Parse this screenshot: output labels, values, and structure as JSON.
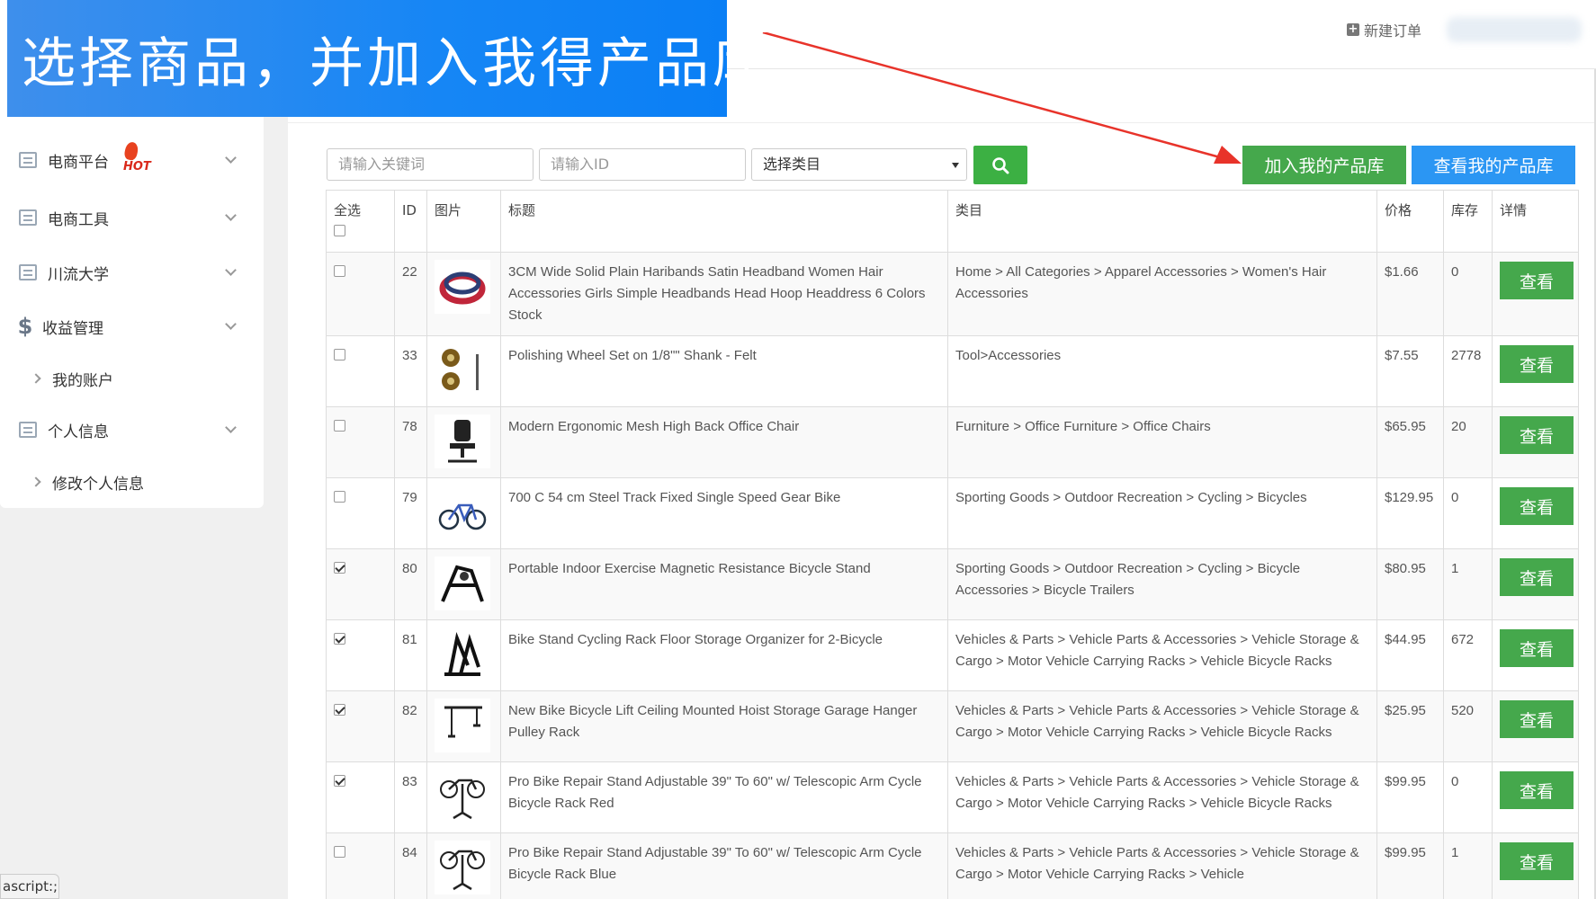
{
  "banner": {
    "text": "选择商品，并加入我得产品库"
  },
  "header": {
    "new_order_label": "新建订单"
  },
  "sidebar": {
    "items": [
      {
        "label": "电商平台",
        "badge": "HOT"
      },
      {
        "label": "电商工具"
      },
      {
        "label": "川流大学"
      },
      {
        "label": "收益管理"
      },
      {
        "label": "我的账户"
      },
      {
        "label": "个人信息"
      },
      {
        "label": "修改个人信息"
      }
    ]
  },
  "status_bar": {
    "text": "ascript:;"
  },
  "search": {
    "keyword_placeholder": "请输入关键词",
    "id_placeholder": "请输入ID",
    "category_select": "选择类目"
  },
  "actions": {
    "add_label": "加入我的产品库",
    "view_label": "查看我的产品库"
  },
  "table": {
    "headers": {
      "select_all": "全选",
      "id": "ID",
      "image": "图片",
      "title": "标题",
      "category": "类目",
      "price": "价格",
      "stock": "库存",
      "detail": "详情"
    },
    "detail_button_label": "查看",
    "rows": [
      {
        "checked": false,
        "id": "22",
        "image_icon": "headband-icon",
        "title": "3CM Wide Solid Plain Haribands Satin Headband Women Hair Accessories Girls Simple Headbands Head Hoop Headdress 6 Colors Stock",
        "category": "Home > All Categories > Apparel Accessories > Women's Hair Accessories",
        "price": "$1.66",
        "stock": "0"
      },
      {
        "checked": false,
        "id": "33",
        "image_icon": "polishing-wheel-icon",
        "title": "Polishing Wheel Set on 1/8\"\" Shank - Felt",
        "category": "Tool>Accessories",
        "price": "$7.55",
        "stock": "2778"
      },
      {
        "checked": false,
        "id": "78",
        "image_icon": "office-chair-icon",
        "title": "Modern Ergonomic Mesh High Back Office Chair",
        "category": "Furniture > Office Furniture > Office Chairs",
        "price": "$65.95",
        "stock": "20"
      },
      {
        "checked": false,
        "id": "79",
        "image_icon": "bike-icon",
        "title": "700 C 54 cm Steel Track Fixed Single Speed Gear Bike",
        "category": "Sporting Goods > Outdoor Recreation > Cycling > Bicycles",
        "price": "$129.95",
        "stock": "0"
      },
      {
        "checked": true,
        "id": "80",
        "image_icon": "bike-stand-icon",
        "title": "Portable Indoor Exercise Magnetic Resistance Bicycle Stand",
        "category": "Sporting Goods > Outdoor Recreation > Cycling > Bicycle Accessories > Bicycle Trailers",
        "price": "$80.95",
        "stock": "1"
      },
      {
        "checked": true,
        "id": "81",
        "image_icon": "bike-rack-icon",
        "title": "Bike Stand Cycling Rack Floor Storage Organizer for 2-Bicycle",
        "category": "Vehicles & Parts > Vehicle Parts & Accessories > Vehicle Storage & Cargo > Motor Vehicle Carrying Racks > Vehicle Bicycle Racks",
        "price": "$44.95",
        "stock": "672"
      },
      {
        "checked": true,
        "id": "82",
        "image_icon": "bike-hoist-icon",
        "title": "New Bike Bicycle Lift Ceiling Mounted Hoist Storage Garage Hanger Pulley Rack",
        "category": "Vehicles & Parts > Vehicle Parts & Accessories > Vehicle Storage & Cargo > Motor Vehicle Carrying Racks > Vehicle Bicycle Racks",
        "price": "$25.95",
        "stock": "520"
      },
      {
        "checked": true,
        "id": "83",
        "image_icon": "repair-stand-icon",
        "title": "Pro Bike Repair Stand Adjustable 39\" To 60\" w/ Telescopic Arm Cycle Bicycle Rack Red",
        "category": "Vehicles & Parts > Vehicle Parts & Accessories > Vehicle Storage & Cargo > Motor Vehicle Carrying Racks > Vehicle Bicycle Racks",
        "price": "$99.95",
        "stock": "0"
      },
      {
        "checked": false,
        "id": "84",
        "image_icon": "repair-stand-icon",
        "title": "Pro Bike Repair Stand Adjustable 39\" To 60\" w/ Telescopic Arm Cycle Bicycle Rack Blue",
        "category": "Vehicles & Parts > Vehicle Parts & Accessories > Vehicle Storage & Cargo > Motor Vehicle Carrying Racks > Vehicle",
        "price": "$99.95",
        "stock": "1"
      }
    ]
  },
  "colors": {
    "banner": "#1686f5",
    "primary_green": "#45a84c",
    "primary_blue": "#2b96f3",
    "annotation_arrow": "#e8332a"
  }
}
